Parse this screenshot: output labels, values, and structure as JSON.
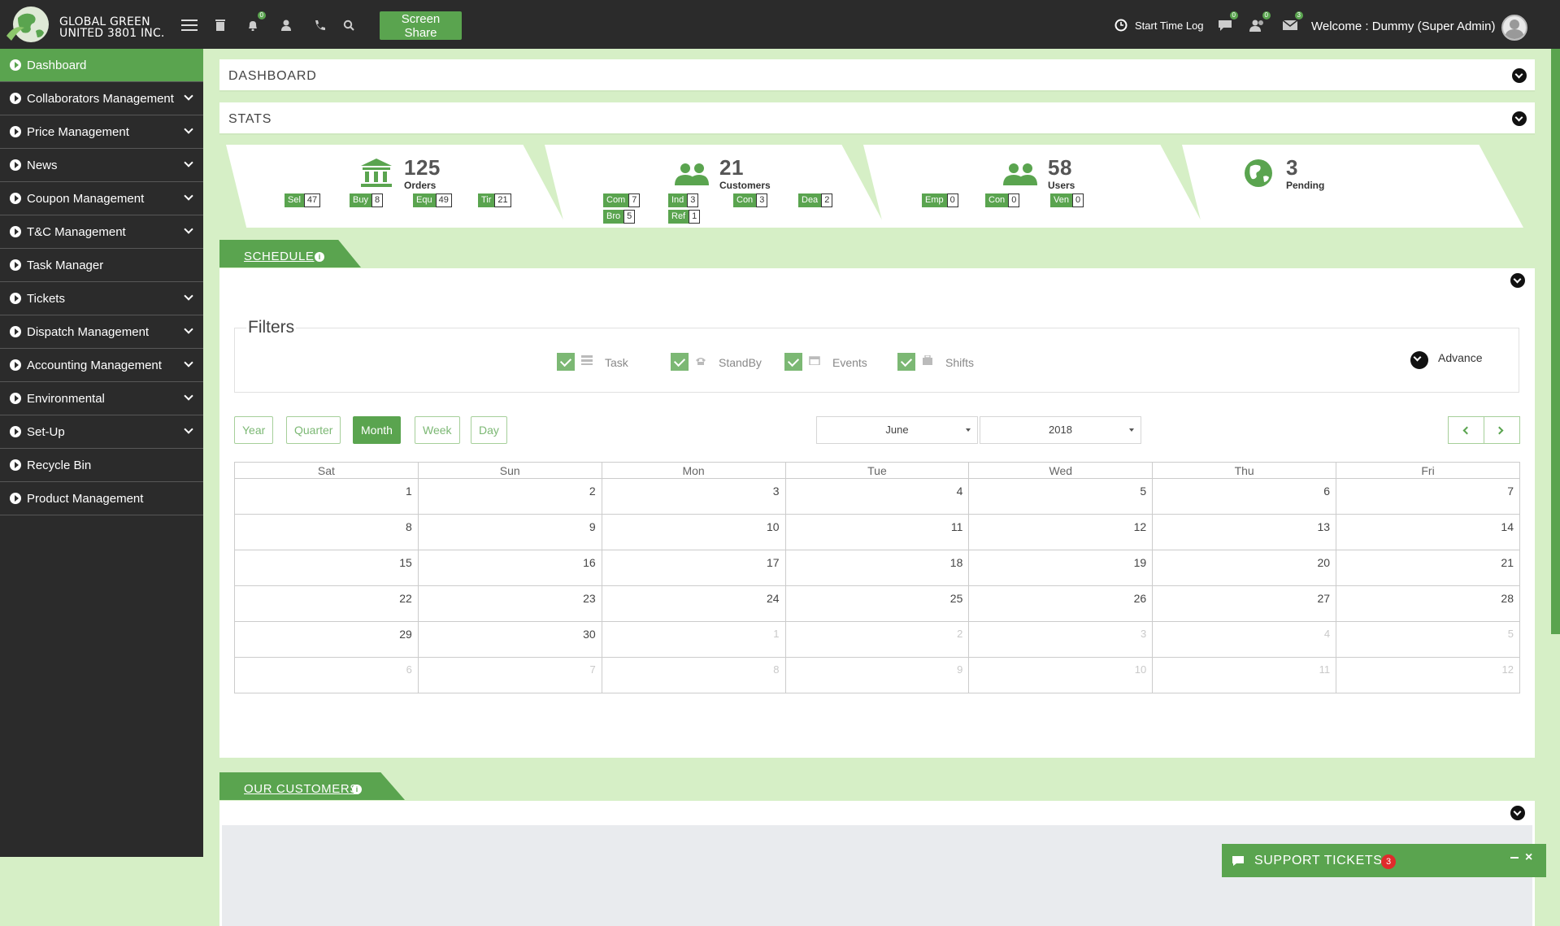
{
  "header": {
    "brand_line1": "GLOBAL GREEN",
    "brand_line2": "UNITED 3801 INC.",
    "notifications_count": "0",
    "screen_share_label": "Screen Share",
    "start_time_log": "Start Time Log",
    "messages_count": "0",
    "users_count": "0",
    "mail_count": "3",
    "welcome": "Welcome : Dummy (Super Admin)"
  },
  "sidebar": {
    "items": [
      {
        "label": "Dashboard",
        "active": true
      },
      {
        "label": "Collaborators Management"
      },
      {
        "label": "Price Management"
      },
      {
        "label": "News"
      },
      {
        "label": "Coupon Management"
      },
      {
        "label": "T&C Management"
      },
      {
        "label": "Task Manager"
      },
      {
        "label": "Tickets"
      },
      {
        "label": "Dispatch Management"
      },
      {
        "label": "Accounting Management"
      },
      {
        "label": "Environmental"
      },
      {
        "label": "Set-Up"
      },
      {
        "label": "Recycle Bin"
      },
      {
        "label": "Product Management"
      }
    ]
  },
  "dashboard": {
    "title": "DASHBOARD"
  },
  "stats": {
    "title": "STATS",
    "orders": {
      "value": "125",
      "label": "Orders",
      "chips": [
        {
          "k": "Sel",
          "v": "47"
        },
        {
          "k": "Buy",
          "v": "8"
        },
        {
          "k": "Equ",
          "v": "49"
        },
        {
          "k": "Tir",
          "v": "21"
        }
      ]
    },
    "customers": {
      "value": "21",
      "label": "Customers",
      "chips": [
        {
          "k": "Com",
          "v": "7"
        },
        {
          "k": "Ind",
          "v": "3"
        },
        {
          "k": "Con",
          "v": "3"
        },
        {
          "k": "Dea",
          "v": "2"
        },
        {
          "k": "Bro",
          "v": "5"
        },
        {
          "k": "Ref",
          "v": "1"
        }
      ]
    },
    "users": {
      "value": "58",
      "label": "Users",
      "chips": [
        {
          "k": "Emp",
          "v": "0"
        },
        {
          "k": "Con",
          "v": "0"
        },
        {
          "k": "Ven",
          "v": "0"
        }
      ]
    },
    "pending": {
      "value": "3",
      "label": "Pending"
    }
  },
  "schedule": {
    "title": "SCHEDULE",
    "filters_title": "Filters",
    "filters": [
      "Task",
      "StandBy",
      "Events",
      "Shifts"
    ],
    "advance": "Advance",
    "views": [
      "Year",
      "Quarter",
      "Month",
      "Week",
      "Day"
    ],
    "active_view": "Month",
    "month": "June",
    "year": "2018",
    "weekdays": [
      "Sat",
      "Sun",
      "Mon",
      "Tue",
      "Wed",
      "Thu",
      "Fri"
    ],
    "weeks": [
      [
        "1",
        "2",
        "3",
        "4",
        "5",
        "6",
        "7"
      ],
      [
        "8",
        "9",
        "10",
        "11",
        "12",
        "13",
        "14"
      ],
      [
        "15",
        "16",
        "17",
        "18",
        "19",
        "20",
        "21"
      ],
      [
        "22",
        "23",
        "24",
        "25",
        "26",
        "27",
        "28"
      ],
      [
        "29",
        "30",
        "1",
        "2",
        "3",
        "4",
        "5"
      ],
      [
        "6",
        "7",
        "8",
        "9",
        "10",
        "11",
        "12"
      ]
    ]
  },
  "customers": {
    "title": "OUR CUSTOMERS"
  },
  "support": {
    "label": "SUPPORT TICKETS",
    "count": "3"
  },
  "colors": {
    "accent": "#5aa44f",
    "dark": "#2b2b2b",
    "page_bg": "#d6efc6"
  }
}
